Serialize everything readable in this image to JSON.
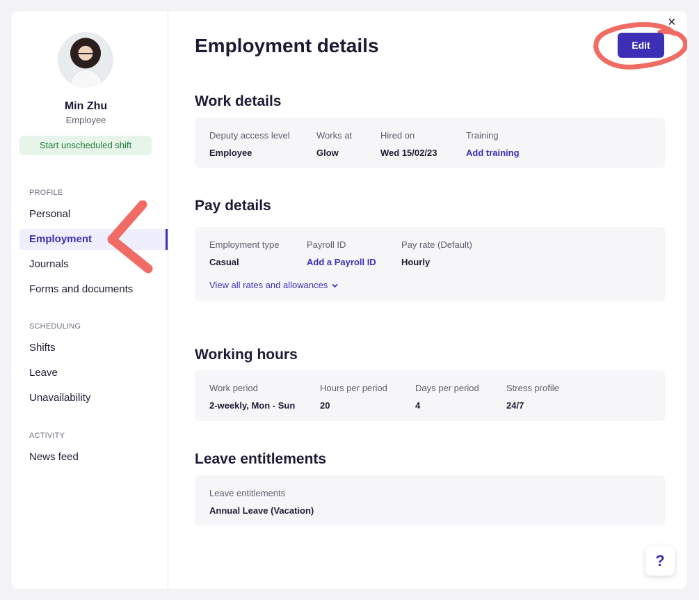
{
  "profile": {
    "name": "Min Zhu",
    "role": "Employee",
    "shift_button": "Start unscheduled shift"
  },
  "sidebar": {
    "sections": [
      {
        "label": "PROFILE",
        "items": [
          "Personal",
          "Employment",
          "Journals",
          "Forms and documents"
        ]
      },
      {
        "label": "SCHEDULING",
        "items": [
          "Shifts",
          "Leave",
          "Unavailability"
        ]
      },
      {
        "label": "ACTIVITY",
        "items": [
          "News feed"
        ]
      }
    ],
    "active_item": "Employment"
  },
  "main": {
    "title": "Employment details",
    "edit_label": "Edit",
    "close_icon": "×",
    "work_details": {
      "title": "Work details",
      "fields": [
        {
          "label": "Deputy access level",
          "value": "Employee"
        },
        {
          "label": "Works at",
          "value": "Glow"
        },
        {
          "label": "Hired on",
          "value": "Wed 15/02/23"
        },
        {
          "label": "Training",
          "value": "Add training"
        }
      ]
    },
    "pay_details": {
      "title": "Pay details",
      "fields": [
        {
          "label": "Employment type",
          "value": "Casual"
        },
        {
          "label": "Payroll ID",
          "value": "Add a Payroll ID"
        },
        {
          "label": "Pay rate (Default)",
          "value": "Hourly"
        }
      ],
      "view_rates": "View all rates and allowances"
    },
    "working_hours": {
      "title": "Working hours",
      "fields": [
        {
          "label": "Work period",
          "value": "2-weekly, Mon - Sun"
        },
        {
          "label": "Hours per period",
          "value": "20"
        },
        {
          "label": "Days per period",
          "value": "4"
        },
        {
          "label": "Stress profile",
          "value": "24/7"
        }
      ]
    },
    "leave": {
      "title": "Leave entitlements",
      "fields": [
        {
          "label": "Leave entitlements",
          "value": "Annual Leave (Vacation)"
        }
      ]
    }
  },
  "help_label": "?",
  "colors": {
    "accent": "#3b2fb5",
    "annotation": "#f06b63",
    "shift_button_bg": "#e6f4ea",
    "shift_button_text": "#227a37"
  },
  "icons": [
    "close-icon",
    "chevron-down-icon",
    "help-icon"
  ]
}
